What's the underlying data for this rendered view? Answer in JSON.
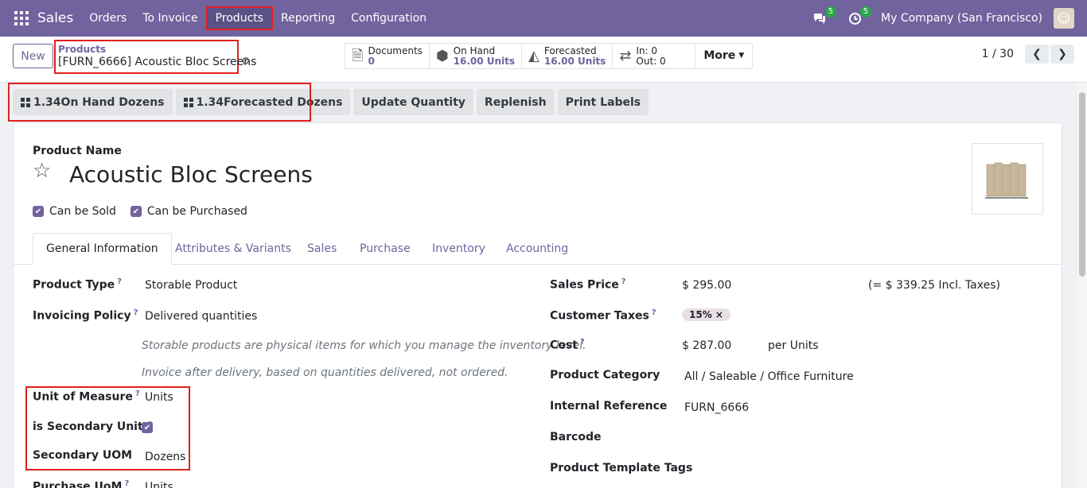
{
  "navbar": {
    "brand": "Sales",
    "menu": [
      {
        "label": "Orders"
      },
      {
        "label": "To Invoice"
      },
      {
        "label": "Products"
      },
      {
        "label": "Reporting"
      },
      {
        "label": "Configuration"
      }
    ],
    "messages_count": "5",
    "activities_count": "5",
    "company": "My Company (San Francisco)"
  },
  "control": {
    "new_label": "New",
    "breadcrumb_parent": "Products",
    "breadcrumb_current": "[FURN_6666] Acoustic Bloc Screens",
    "smart_buttons": {
      "documents_label": "Documents",
      "documents_value": "0",
      "onhand_label": "On Hand",
      "onhand_value": "16.00 Units",
      "forecasted_label": "Forecasted",
      "forecasted_value": "16.00 Units",
      "in_label": "In: 0",
      "out_label": "Out: 0",
      "more_label": "More"
    },
    "pager": "1 / 30"
  },
  "actions": {
    "onhand_dozens": "1.34On Hand Dozens",
    "forecasted_dozens": "1.34Forecasted Dozens",
    "update_quantity": "Update Quantity",
    "replenish": "Replenish",
    "print_labels": "Print Labels"
  },
  "form": {
    "product_name_label": "Product Name",
    "product_name": "Acoustic Bloc Screens",
    "can_be_sold": "Can be Sold",
    "can_be_purchased": "Can be Purchased",
    "tabs": [
      "General Information",
      "Attributes & Variants",
      "Sales",
      "Purchase",
      "Inventory",
      "Accounting"
    ],
    "left": {
      "product_type_label": "Product Type",
      "product_type": "Storable Product",
      "invoicing_policy_label": "Invoicing Policy",
      "invoicing_policy": "Delivered quantities",
      "help1": "Storable products are physical items for which you manage the inventory level.",
      "help2": "Invoice after delivery, based on quantities delivered, not ordered.",
      "uom_label": "Unit of Measure",
      "uom": "Units",
      "secondary_unit_label": "is Secondary Unit ?",
      "secondary_uom_label": "Secondary UOM",
      "secondary_uom": "Dozens",
      "purchase_uom_label": "Purchase UoM",
      "purchase_uom": "Units"
    },
    "right": {
      "sales_price_label": "Sales Price",
      "sales_price": "$ 295.00",
      "incl_taxes": "(= $ 339.25 Incl. Taxes)",
      "customer_taxes_label": "Customer Taxes",
      "tax_tag": "15% ×",
      "cost_label": "Cost",
      "cost": "$ 287.00",
      "cost_per": "per Units",
      "category_label": "Product Category",
      "category": "All / Saleable / Office Furniture",
      "internal_ref_label": "Internal Reference",
      "internal_ref": "FURN_6666",
      "barcode_label": "Barcode",
      "template_tags_label": "Product Template Tags"
    }
  }
}
